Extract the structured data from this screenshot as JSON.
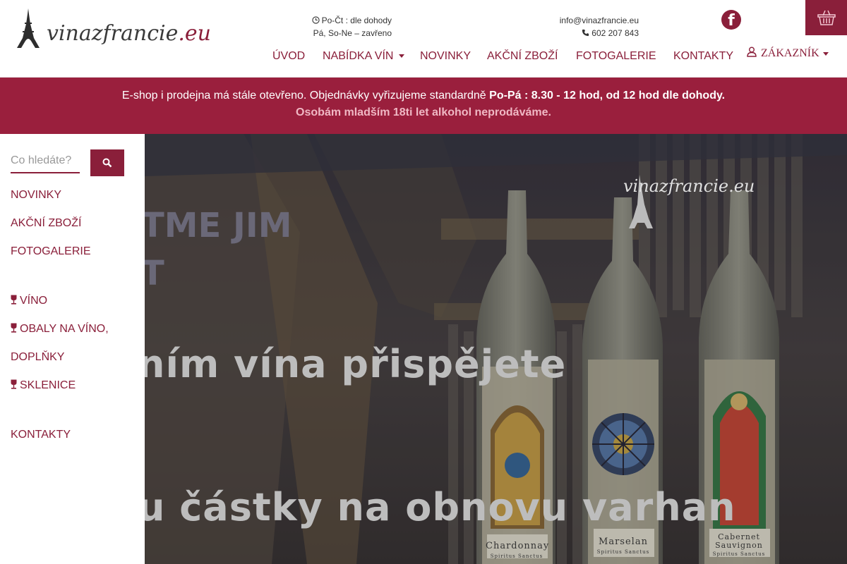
{
  "header": {
    "logo_text": "vinazfrancie",
    "logo_tld": ".eu",
    "hours_line1": "Po-Čt : dle dohody",
    "hours_line2": "Pá, So-Ne – zavřeno",
    "email": "info@vinazfrancie.eu",
    "phone": "602 207 843",
    "facebook_icon": "facebook-icon",
    "cart_icon": "basket-icon"
  },
  "nav": {
    "items": [
      "ÚVOD",
      "NABÍDKA VÍN",
      "NOVINKY",
      "AKČNÍ ZBOŽÍ",
      "FOTOGALERIE",
      "KONTAKTY"
    ],
    "customer": "ZÁKAZNÍK"
  },
  "banner": {
    "text": "E-shop i prodejna má stále otevřeno. Objednávky vyřizujeme standardně",
    "bold": "Po-Pá : 8.30 - 12 hod, od 12 hod dle dohody.",
    "sub": "Osobám mladším 18ti let alkohol neprodáváme."
  },
  "search": {
    "placeholder": "Co hledáte?"
  },
  "sidebar": {
    "items": [
      "NOVINKY",
      "AKČNÍ ZBOŽÍ",
      "FOTOGALERIE",
      "VÍNO",
      "OBALY NA VÍNO,",
      "DOPLŇKY",
      "SKLENICE",
      "KONTAKTY"
    ]
  },
  "hero": {
    "top_line1": "TME JIM",
    "top_line2": "T",
    "line1": "ním vína přispějete",
    "line2": "u částky na obnovu varhan",
    "logo": "vinazfrancie.eu",
    "bottle1": "Chardonnay",
    "bottle1_sub": "Spiritus Sanctus",
    "bottle2": "Marselan",
    "bottle2_sub": "Spiritus Sanctus",
    "bottle3_a": "Cabernet",
    "bottle3_b": "Sauvignon",
    "bottle3_sub": "Spiritus Sanctus"
  },
  "colors": {
    "brand": "#8a1f3a",
    "banner": "#9a1f3d"
  }
}
